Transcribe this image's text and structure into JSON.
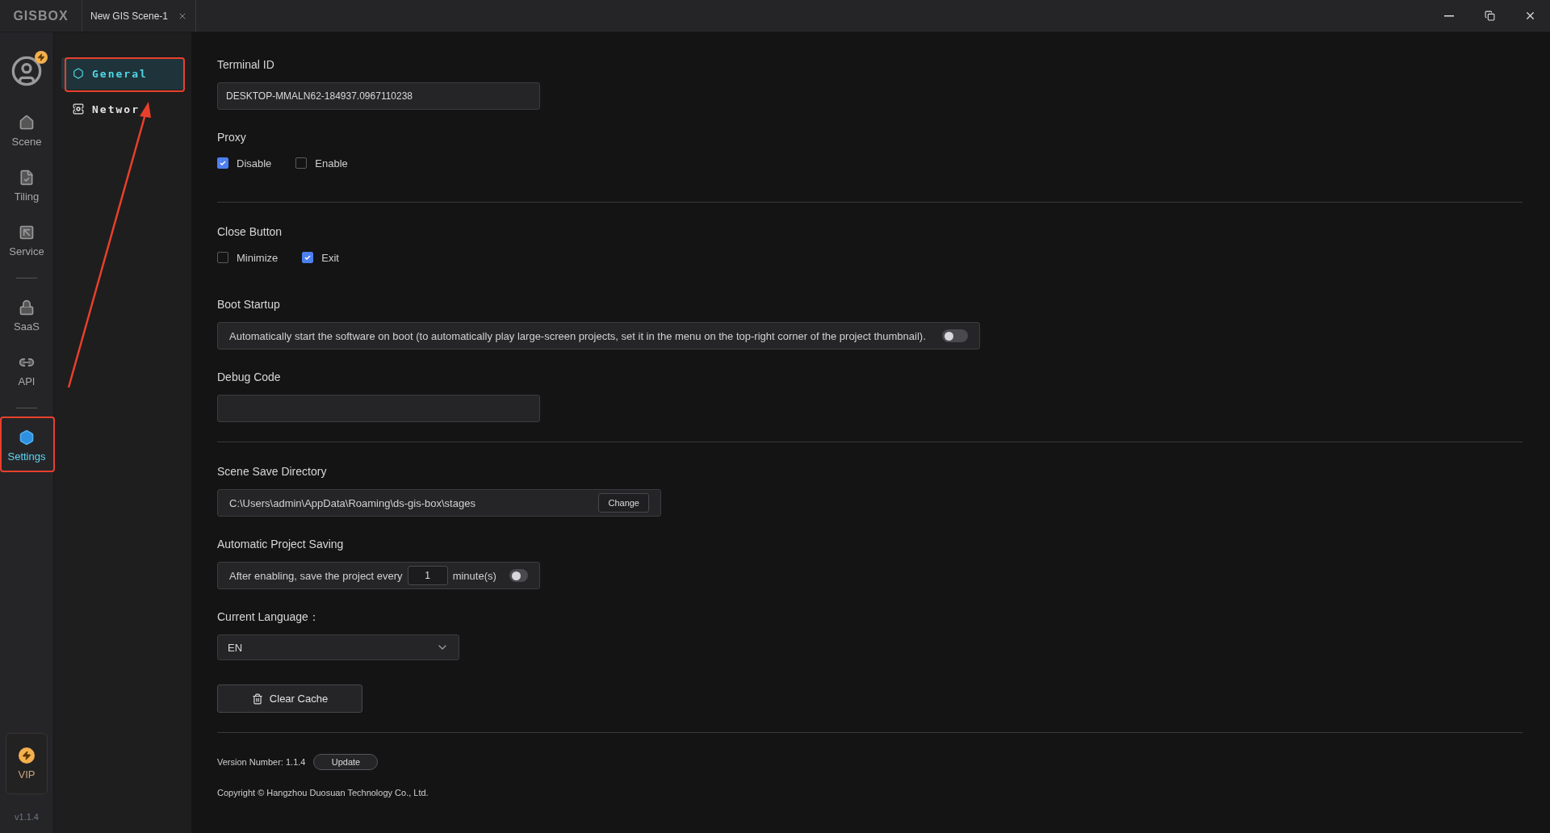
{
  "title_bar": {
    "logo": "GISBOX",
    "tabs": [
      {
        "label": "New GIS Scene-1"
      }
    ]
  },
  "rail": {
    "groups": [
      [
        {
          "label": "Scene",
          "selected": false
        },
        {
          "label": "Tiling",
          "selected": false
        },
        {
          "label": "Service",
          "selected": false
        }
      ],
      [
        {
          "label": "SaaS",
          "selected": false
        },
        {
          "label": "API",
          "selected": false
        }
      ],
      [
        {
          "label": "Settings",
          "selected": true
        }
      ]
    ],
    "vip": "VIP",
    "version": "v1.1.4"
  },
  "submenu": [
    {
      "label": "General",
      "selected": true
    },
    {
      "label": "Networ",
      "selected": false
    }
  ],
  "sections": [
    {
      "kind": "text_field",
      "label": "Terminal ID",
      "value": "DESKTOP-MMALN62-184937.0967110238"
    },
    {
      "kind": "checks",
      "label": "Proxy",
      "options": [
        {
          "label": "Disable",
          "checked": true
        },
        {
          "label": "Enable",
          "checked": false
        }
      ]
    },
    {
      "kind": "divider"
    },
    {
      "kind": "checks",
      "label": "Close Button",
      "options": [
        {
          "label": "Minimize",
          "checked": false
        },
        {
          "label": "Exit",
          "checked": true
        }
      ]
    },
    {
      "kind": "toggle_text",
      "label": "Boot Startup",
      "text": "Automatically start the software on boot (to automatically play large-screen projects, set it in the menu on the top-right corner of the project thumbnail).",
      "on": false
    },
    {
      "kind": "text_field",
      "label": "Debug Code"
    },
    {
      "kind": "divider"
    },
    {
      "kind": "directory",
      "label": "Scene Save Directory",
      "path": "C:\\Users\\admin\\AppData\\Roaming\\ds-gis-box\\stages",
      "button": "Change"
    },
    {
      "kind": "autosave",
      "label": "Automatic Project Saving",
      "prefix": "After enabling, save the project every",
      "value": "1",
      "suffix": "minute(s)",
      "on": false
    },
    {
      "kind": "select",
      "label": "Current Language：",
      "value": "EN"
    },
    {
      "kind": "button",
      "label": "Clear Cache"
    },
    {
      "kind": "divider"
    }
  ],
  "footer": {
    "version": "Version Number: 1.1.4",
    "update": "Update",
    "copyright": "Copyright © Hangzhou Duosuan Technology Co., Ltd."
  }
}
